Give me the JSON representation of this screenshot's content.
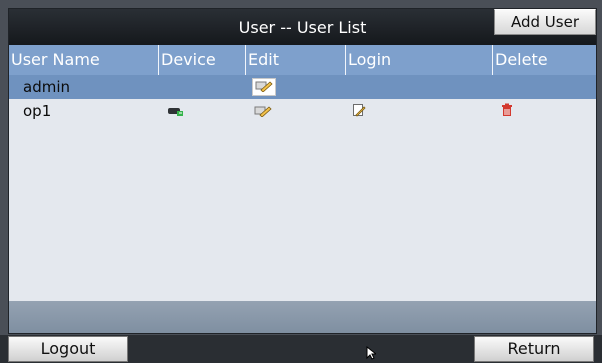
{
  "window": {
    "title": "User -- User List",
    "add_user_label": "Add User"
  },
  "table": {
    "columns": [
      "User Name",
      "Device",
      "Edit",
      "Login",
      "Delete"
    ],
    "rows": [
      {
        "user": "admin",
        "device_icon": "",
        "edit_icon": "edit-icon",
        "login_icon": "",
        "delete_icon": "",
        "selected": true
      },
      {
        "user": "op1",
        "device_icon": "device-icon",
        "edit_icon": "edit-icon",
        "login_icon": "login-edit-icon",
        "delete_icon": "trash-icon",
        "selected": false
      }
    ]
  },
  "footer": {
    "logout_label": "Logout",
    "return_label": "Return"
  },
  "colors": {
    "header": "#7ea0cc",
    "selected_row": "#6f92bf",
    "delete_icon": "#d3392f"
  }
}
